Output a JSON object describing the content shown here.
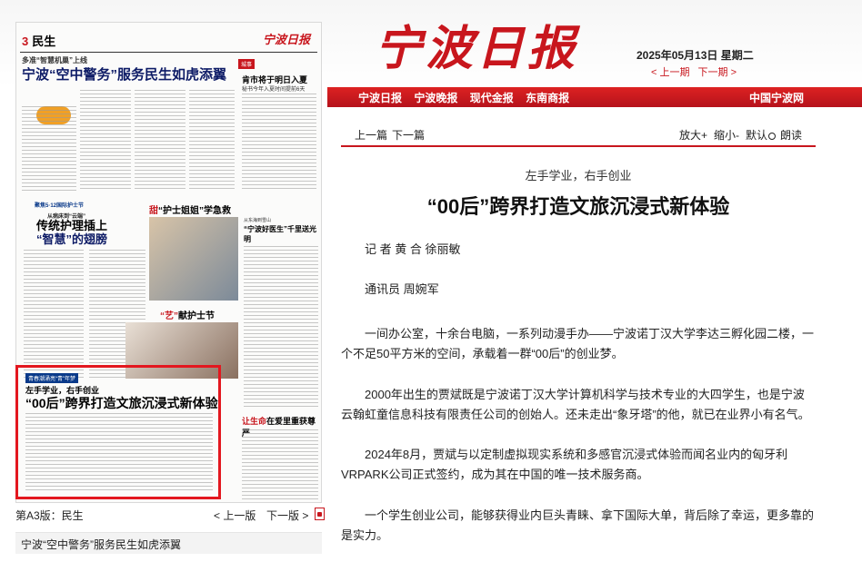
{
  "masthead": {
    "logo": "宁波日报",
    "date": "2025年05月13日 星期二",
    "prev_issue": "< 上一期",
    "next_issue": "下一期 >"
  },
  "nav": {
    "links": [
      "宁波日报",
      "宁波晚报",
      "现代金报",
      "东南商报"
    ],
    "right_link": "中国宁波网"
  },
  "thumbnail": {
    "page_no": "3",
    "section": "民生",
    "logo": "宁波日报",
    "kicker": "多准“智慧机巢”上线",
    "headline": "宁波“空中警务”服务民生如虎添翼",
    "badge": "城事",
    "right_title": "肯市将于明日入夏",
    "right_sub": "秘书今年入夏时间提前6天",
    "section_label": "聚焦5·12国际护士节",
    "nurse_kicker": "从病床到“云端”",
    "nurse_title_1": "传统护理插上",
    "nurse_title_2": "“智慧”的翅膀",
    "mid_title_a": "甜",
    "mid_title_b": "“护士姐姐”学急救",
    "right2_kicker": "从东海到雪山",
    "right2_title": "“宁波好医生”千里送光明",
    "art_title_a": "“艺”",
    "art_title_b": "献护士节",
    "bottom_right_a": "让生命",
    "bottom_right_b": "在爱里重获尊严",
    "hl_kicker": "青春潮涌亮“青”年梦",
    "hl_sub": "左手学业，右手创业",
    "hl_title": "“00后”跨界打造文旅沉浸式新体验"
  },
  "page_nav": {
    "current": "第A3版：民生",
    "prev": "< 上一版",
    "next": "下一版 >"
  },
  "article_list": [
    "宁波“空中警务”服务民生如虎添翼"
  ],
  "toolbar": {
    "prev": "上一篇",
    "next": "下一篇",
    "zoom_in": "放大+",
    "zoom_out": "缩小-",
    "default": "默认",
    "read": "朗读"
  },
  "article": {
    "subtitle": "左手学业，右手创业",
    "title": "“00后”跨界打造文旅沉浸式新体验",
    "byline": "记 者 黄 合 徐丽敏",
    "correspondent": "通讯员 周婉军",
    "paragraphs": [
      "一间办公室，十余台电脑，一系列动漫手办——宁波诺丁汉大学李达三孵化园二楼，一个不足50平方米的空间，承载着一群“00后”的创业梦。",
      "2000年出生的贾斌既是宁波诺丁汉大学计算机科学与技术专业的大四学生，也是宁波云翰虹童信息科技有限责任公司的创始人。还未走出“象牙塔”的他，就已在业界小有名气。",
      "2024年8月，贾斌与以定制虚拟现实系统和多感官沉浸式体验而闻名业内的匈牙利VRPARK公司正式签约，成为其在中国的唯一技术服务商。",
      "一个学生创业公司，能够获得业内巨头青睐、拿下国际大单，背后除了幸运，更多靠的是实力。"
    ]
  },
  "colors": {
    "brand_red": "#c8161d",
    "navy": "#0d1b66"
  }
}
